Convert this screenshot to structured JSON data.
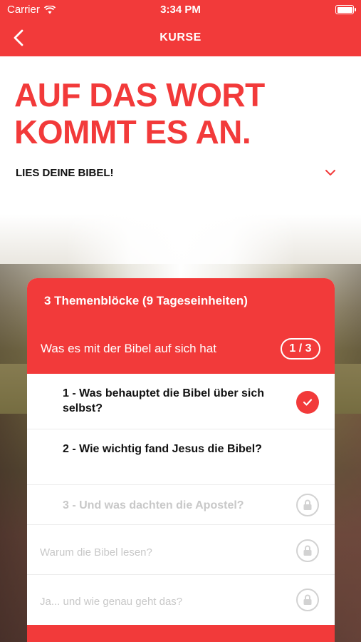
{
  "status_bar": {
    "carrier": "Carrier",
    "time": "3:34 PM"
  },
  "nav": {
    "title": "KURSE"
  },
  "headline": {
    "line1": "AUF DAS WORT",
    "line2": "KOMMT ES AN."
  },
  "subhead": "LIES DEINE BIBEL!",
  "card": {
    "blocks_label": "3 Themenblöcke (9 Tageseinheiten)",
    "section_title": "Was es mit der Bibel auf sich hat",
    "progress": "1 / 3",
    "items": [
      {
        "label": "1 - Was behauptet die Bibel über sich selbst?",
        "state": "done",
        "icon": "check-icon"
      },
      {
        "label": "2 - Wie wichtig fand Jesus die Bibel?",
        "state": "open"
      },
      {
        "label": "3 - Und was dachten die Apostel?",
        "state": "locked",
        "icon": "lock-icon"
      },
      {
        "label": "Warum die Bibel lesen?",
        "state": "locked",
        "icon": "lock-icon"
      },
      {
        "label": "Ja... und wie genau geht das?",
        "state": "locked",
        "icon": "lock-icon"
      }
    ]
  },
  "colors": {
    "accent": "#f23a3a",
    "disabled": "#c8c8c8"
  }
}
